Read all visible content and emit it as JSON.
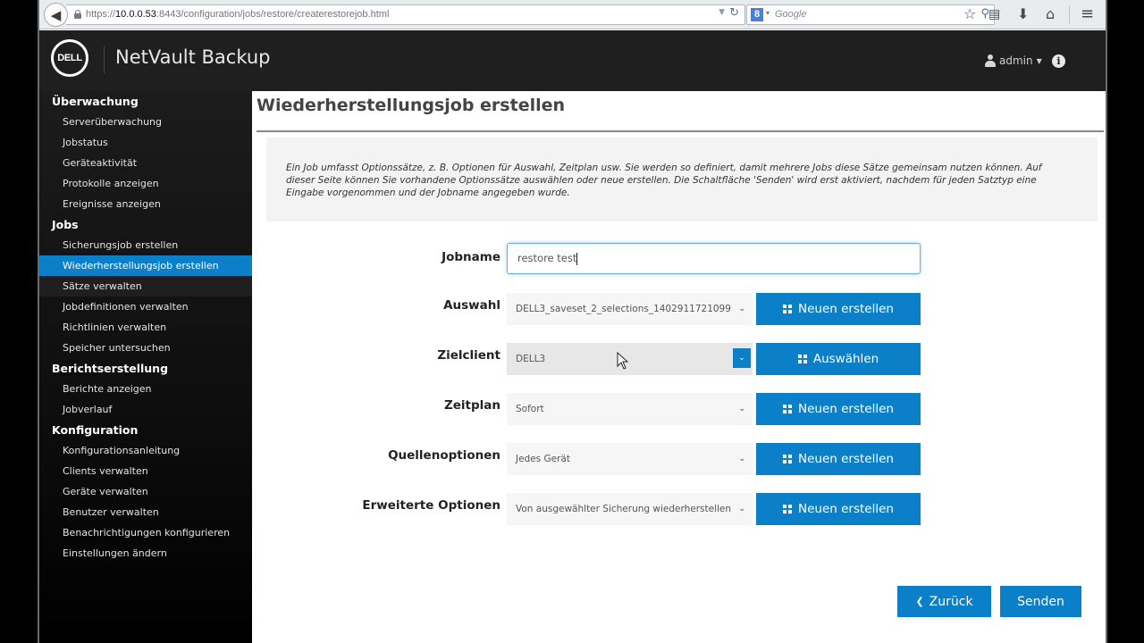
{
  "browser": {
    "url_prefix": "https://",
    "url_host": "10.0.0.53",
    "url_rest": ":8443/configuration/jobs/restore/createrestorejob.html",
    "search_placeholder": "Google",
    "search_engine_icon": "8"
  },
  "app": {
    "logo_text": "DELL",
    "title": "NetVault Backup",
    "user": "admin"
  },
  "sidebar": {
    "groups": [
      {
        "label": "Überwachung",
        "items": [
          "Serverüberwachung",
          "Jobstatus",
          "Geräteaktivität",
          "Protokolle anzeigen",
          "Ereignisse anzeigen"
        ]
      },
      {
        "label": "Jobs",
        "items": [
          "Sicherungsjob erstellen",
          "Wiederherstellungsjob erstellen",
          "Sätze verwalten",
          "Jobdefinitionen verwalten",
          "Richtlinien verwalten",
          "Speicher untersuchen"
        ]
      },
      {
        "label": "Berichtserstellung",
        "items": [
          "Berichte anzeigen",
          "Jobverlauf"
        ]
      },
      {
        "label": "Konfiguration",
        "items": [
          "Konfigurationsanleitung",
          "Clients verwalten",
          "Geräte verwalten",
          "Benutzer verwalten",
          "Benachrichtigungen konfigurieren",
          "Einstellungen ändern"
        ]
      }
    ],
    "active_item": "Wiederherstellungsjob erstellen"
  },
  "main": {
    "page_title": "Wiederherstellungsjob erstellen",
    "info_text": "Ein Job umfasst Optionssätze, z. B. Optionen für Auswahl, Zeitplan usw. Sie werden so definiert, damit mehrere Jobs diese Sätze gemeinsam nutzen können. Auf dieser Seite können Sie vorhandene Optionssätze auswählen oder neue erstellen. Die Schaltfläche 'Senden' wird erst aktiviert, nachdem für jeden Satztyp eine Eingabe vorgenommen und der Jobname angegeben wurde.",
    "form": {
      "jobname": {
        "label": "Jobname",
        "value": "restore test"
      },
      "rows": [
        {
          "label": "Auswahl",
          "value": "DELL3_saveset_2_selections_1402911721099",
          "button": "Neuen erstellen"
        },
        {
          "label": "Zielclient",
          "value": "DELL3",
          "button": "Auswählen"
        },
        {
          "label": "Zeitplan",
          "value": "Sofort",
          "button": "Neuen erstellen"
        },
        {
          "label": "Quellenoptionen",
          "value": "Jedes Gerät",
          "button": "Neuen erstellen"
        },
        {
          "label": "Erweiterte Optionen",
          "value": "Von ausgewählter Sicherung wiederherstellen",
          "button": "Neuen erstellen"
        }
      ]
    },
    "back_button": "Zurück",
    "submit_button": "Senden"
  },
  "colors": {
    "accent": "#0b7fc7",
    "header_bg": "#1f1f1f",
    "sidebar_bg": "#111111"
  }
}
